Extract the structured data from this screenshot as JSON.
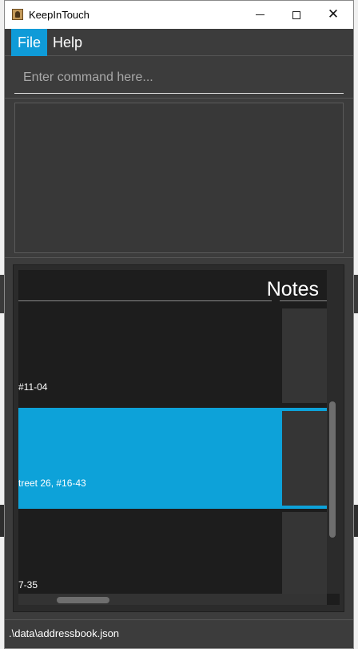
{
  "window": {
    "title": "KeepInTouch",
    "minimize_label": "",
    "maximize_label": "",
    "close_label": "✕"
  },
  "menu": {
    "items": [
      {
        "label": "File",
        "active": true
      },
      {
        "label": "Help",
        "active": false
      }
    ]
  },
  "command": {
    "placeholder": "Enter command here...",
    "value": ""
  },
  "result_display": {
    "text": ""
  },
  "list": {
    "notes_header": "Notes",
    "rows": [
      {
        "text": "#11-04",
        "selected": false
      },
      {
        "text": "treet 26, #16-43",
        "selected": true
      },
      {
        "text": "7-35",
        "selected": false
      }
    ]
  },
  "status": {
    "save_location": ".\\data\\addressbook.json"
  },
  "colors": {
    "accent": "#0da2d9",
    "background": "#3c3c3c",
    "list_background": "#1d1d1d"
  }
}
